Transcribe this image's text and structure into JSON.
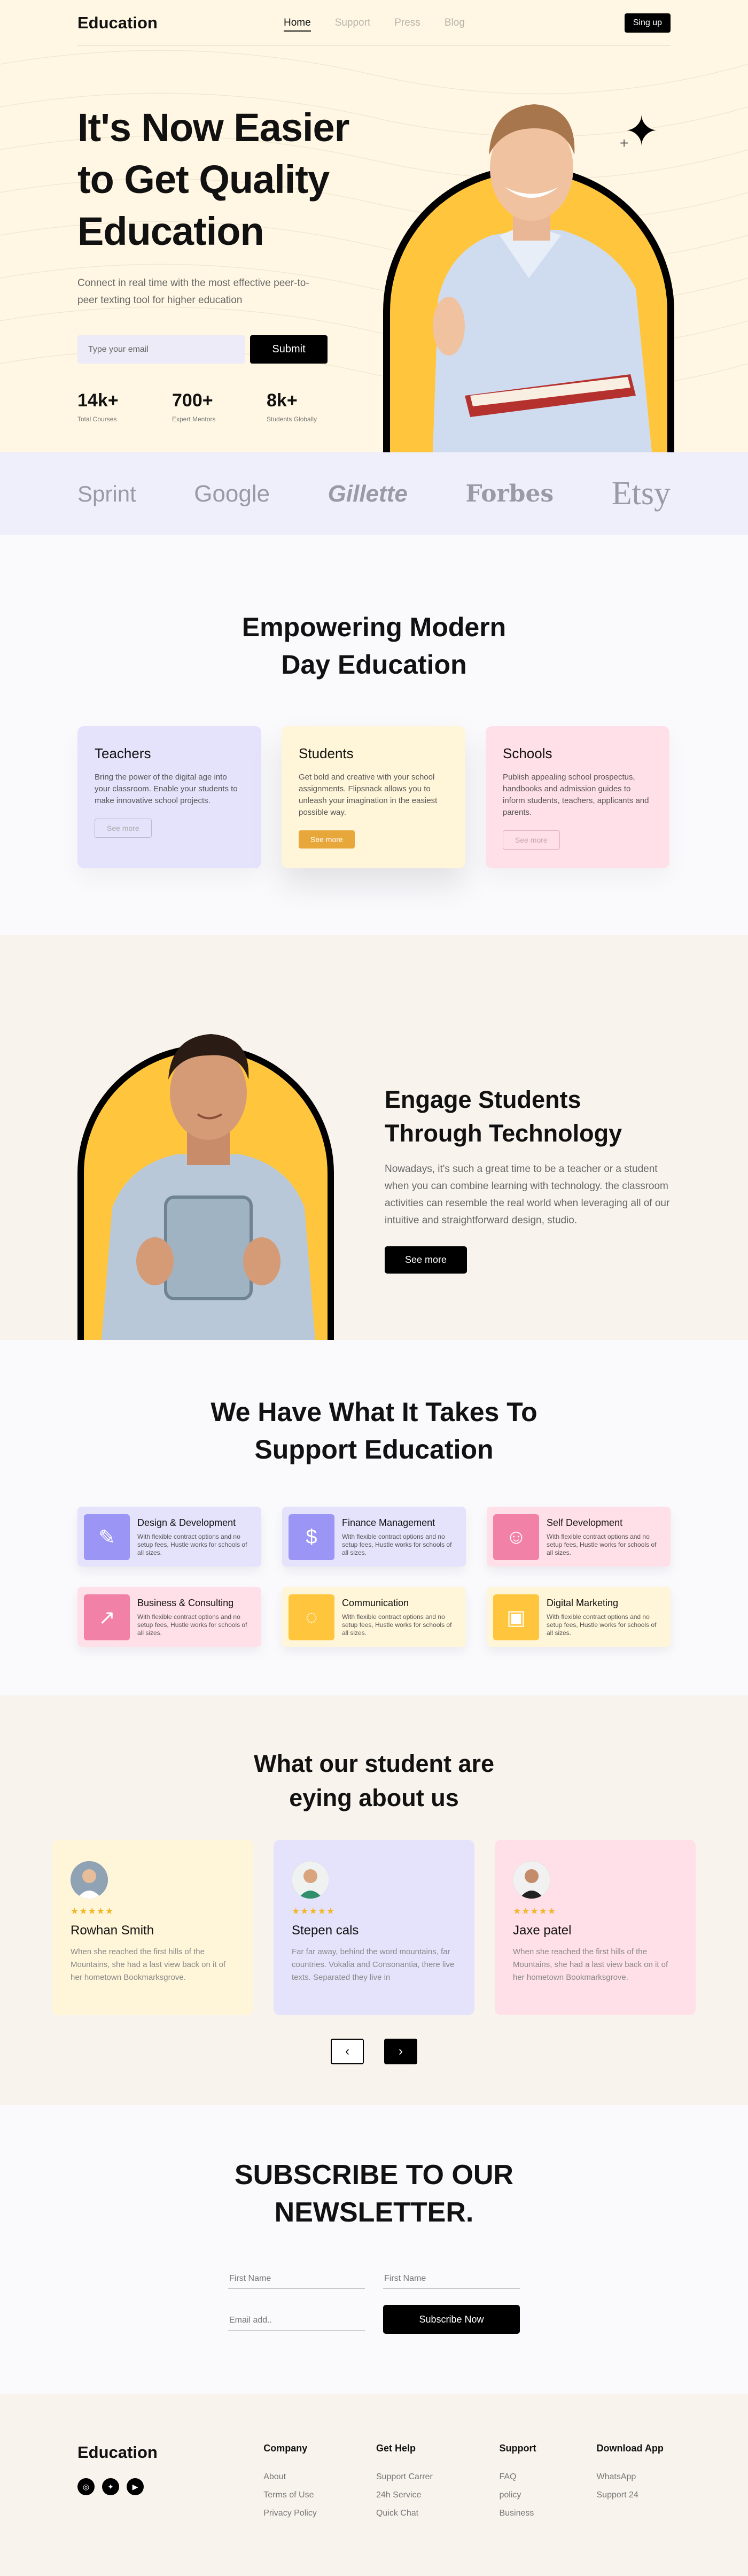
{
  "nav": {
    "logo": "Education",
    "links": [
      "Home",
      "Support",
      "Press",
      "Blog"
    ],
    "signup": "Sing up"
  },
  "hero": {
    "title": "It's Now Easier to Get Quality Education",
    "subtitle": "Connect in real time with the most effective peer-to-peer texting tool for higher education",
    "email_placeholder": "Type your email",
    "submit": "Submit",
    "stats": [
      {
        "value": "14k+",
        "label": "Total Courses"
      },
      {
        "value": "700+",
        "label": "Expert Mentors"
      },
      {
        "value": "8k+",
        "label": "Students Globally"
      }
    ]
  },
  "brands": [
    "Sprint",
    "Google",
    "Gillette",
    "Forbes",
    "Etsy"
  ],
  "empower": {
    "title": "Empowering Modern Day Education",
    "cards": [
      {
        "title": "Teachers",
        "text": "Bring the power of the digital age into your classroom. Enable your students to make innovative school projects.",
        "button": "See more"
      },
      {
        "title": "Students",
        "text": "Get bold and creative with your school assignments. Flipsnack allows you to unleash your imagination in the easiest possible way.",
        "button": "See more"
      },
      {
        "title": "Schools",
        "text": "Publish appealing school prospectus, handbooks and admission guides to inform students, teachers, applicants and parents.",
        "button": "See more"
      }
    ]
  },
  "engage": {
    "title": "Engage Students Through Technology",
    "text": "Nowadays, it's such a great time to be a teacher or a student when you can combine learning with technology. the classroom activities can resemble the real world when leveraging all of our intuitive and straightforward design, studio.",
    "button": "See more"
  },
  "takes": {
    "title": "We Have What It Takes To Support Education",
    "services": [
      {
        "title": "Design & Development",
        "text": "With flexible contract options and no setup fees, Hustle works for schools of all sizes.",
        "icon": "design-icon"
      },
      {
        "title": "Finance Management",
        "text": "With flexible contract options and no setup fees, Hustle works for schools of all sizes.",
        "icon": "finance-icon"
      },
      {
        "title": "Self Development",
        "text": "With flexible contract options and no setup fees, Hustle works for schools of all sizes.",
        "icon": "user-icon"
      },
      {
        "title": "Business & Consulting",
        "text": "With flexible contract options and no setup fees, Hustle works for schools of all sizes.",
        "icon": "chart-icon"
      },
      {
        "title": "Communication",
        "text": "With flexible contract options and no setup fees, Hustle works for schools of all sizes.",
        "icon": "chat-icon"
      },
      {
        "title": "Digital Marketing",
        "text": "With flexible contract options and no setup fees, Hustle works for schools of all sizes.",
        "icon": "marketing-icon"
      }
    ]
  },
  "testimonials": {
    "title": "What our student are eying about us",
    "items": [
      {
        "name": "Rowhan Smith",
        "stars": "★★★★★",
        "text": "When she reached the first hills of the Mountains, she had a last view back on it of her hometown Bookmarksgrove."
      },
      {
        "name": "Stepen cals",
        "stars": "★★★★★",
        "text": "Far far away, behind the word mountains, far countries. Vokalia and Consonantia, there live texts. Separated they live in"
      },
      {
        "name": "Jaxe patel",
        "stars": "★★★★★",
        "text": "When she reached the first hills of the Mountains, she had a last view back on it of her hometown Bookmarksgrove."
      }
    ],
    "prev": "‹",
    "next": "›"
  },
  "newsletter": {
    "title": "SUBSCRIBE TO OUR NEWSLETTER.",
    "first_name_1": "First Name",
    "first_name_2": "First Name",
    "email": "Email add..",
    "button": "Subscribe Now"
  },
  "footer": {
    "logo": "Education",
    "columns": [
      {
        "title": "Company",
        "links": [
          "About",
          "Terms of Use",
          "Privacy Policy"
        ]
      },
      {
        "title": "Get Help",
        "links": [
          "Support Carrer",
          "24h Service",
          "Quick Chat"
        ]
      },
      {
        "title": "Support",
        "links": [
          "FAQ",
          "policy",
          "Business"
        ]
      },
      {
        "title": "Download App",
        "links": [
          "WhatsApp",
          "Support 24"
        ]
      }
    ]
  },
  "colors": {
    "accent_yellow": "#ffc63d",
    "purple": "#9b95f5",
    "pink": "#f281a7",
    "cream": "#fff7e3"
  }
}
